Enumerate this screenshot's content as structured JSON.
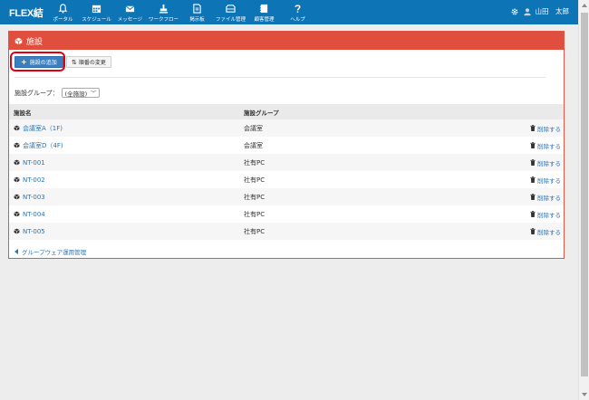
{
  "app": {
    "logo": "FLEX結"
  },
  "nav": [
    {
      "label": "ポータル",
      "icon": "bell-icon"
    },
    {
      "label": "スケジュール",
      "icon": "calendar-icon"
    },
    {
      "label": "メッセージ",
      "icon": "envelope-icon"
    },
    {
      "label": "ワークフロー",
      "icon": "stamp-icon"
    },
    {
      "label": "掲示板",
      "icon": "board-icon"
    },
    {
      "label": "ファイル管理",
      "icon": "folder-icon"
    },
    {
      "label": "顧客管理",
      "icon": "address-book-icon"
    },
    {
      "label": "ヘルプ",
      "icon": "question-icon"
    }
  ],
  "user": {
    "name": "山田　太郎"
  },
  "panel": {
    "title": "施設",
    "add_label": "施設の追加",
    "order_label": "順番の変更"
  },
  "filter": {
    "label": "施設グループ：",
    "selected": "(全施設)"
  },
  "table": {
    "headers": [
      "施設名",
      "施設グループ",
      ""
    ],
    "rows": [
      {
        "name": "会議室A（1F)",
        "group": "会議室",
        "action": "削除する"
      },
      {
        "name": "会議室D（4F)",
        "group": "会議室",
        "action": "削除する"
      },
      {
        "name": "NT-001",
        "group": "社有PC",
        "action": "削除する"
      },
      {
        "name": "NT-002",
        "group": "社有PC",
        "action": "削除する"
      },
      {
        "name": "NT-003",
        "group": "社有PC",
        "action": "削除する"
      },
      {
        "name": "NT-004",
        "group": "社有PC",
        "action": "削除する"
      },
      {
        "name": "NT-005",
        "group": "社有PC",
        "action": "削除する"
      }
    ]
  },
  "back_link": "グループウェア運用管理",
  "colors": {
    "topbar": "#0d74b6",
    "panel_header": "#e04e3d",
    "link": "#2d74b5",
    "highlight": "#e0000f"
  }
}
